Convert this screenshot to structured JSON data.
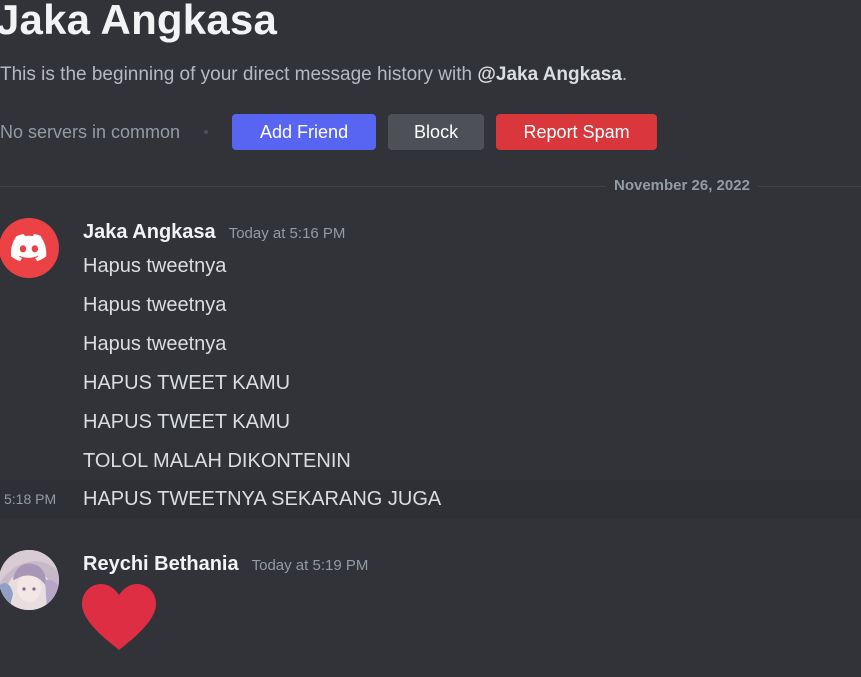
{
  "header": {
    "title": "Jaka Angkasa",
    "description_prefix": "This is the beginning of your direct message history with ",
    "mention": "@Jaka Angkasa",
    "description_suffix": "."
  },
  "actions": {
    "mutual_servers": "No servers in common",
    "add_friend_label": "Add Friend",
    "block_label": "Block",
    "report_spam_label": "Report Spam"
  },
  "divider": {
    "date": "November 26, 2022"
  },
  "messages": [
    {
      "author": "Jaka Angkasa",
      "timestamp": "Today at 5:16 PM",
      "avatar_icon": "discord-logo-icon",
      "lines": [
        "Hapus tweetnya",
        "Hapus tweetnya",
        "Hapus tweetnya",
        "HAPUS TWEET KAMU",
        "HAPUS TWEET KAMU",
        "TOLOL MALAH DIKONTENIN"
      ],
      "followup": {
        "time": "5:18 PM",
        "text": "HAPUS TWEETNYA SEKARANG JUGA"
      }
    },
    {
      "author": "Reychi Bethania",
      "timestamp": "Today at 5:19 PM",
      "avatar_icon": "anime-avatar",
      "emoji": "heart-icon"
    }
  ],
  "colors": {
    "background": "#313338",
    "blurple": "#5865f2",
    "danger": "#da373c",
    "secondary": "#4e5058",
    "heart": "#dd2e44"
  }
}
